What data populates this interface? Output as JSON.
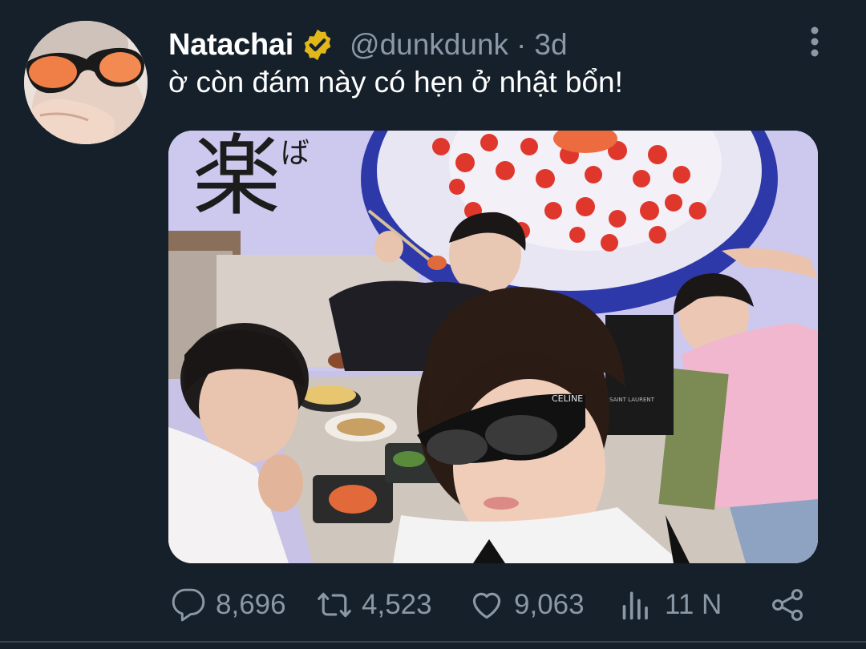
{
  "tweet": {
    "author_name": "Natachai",
    "handle": "@dunkdunk",
    "separator": "·",
    "time": "3d",
    "text": "ờ còn đám này có hẹn ở nhật bổn!",
    "media_icon": "photo",
    "sign_text_1": "楽",
    "sign_text_2": "ば",
    "sunglasses_brand": "CELINE",
    "bag_brand": "SAINT LAURENT"
  },
  "actions": {
    "replies": "8,696",
    "retweets": "4,523",
    "likes": "9,063",
    "views": "11 N"
  },
  "icons": {
    "verified": "verified-badge-icon",
    "more": "more-vertical-icon",
    "reply": "reply-icon",
    "retweet": "retweet-icon",
    "like": "heart-icon",
    "views": "analytics-icon",
    "share": "share-icon"
  },
  "colors": {
    "background": "#15202b",
    "secondary_text": "#8b98a5",
    "verified_gold": "#e2b719"
  }
}
